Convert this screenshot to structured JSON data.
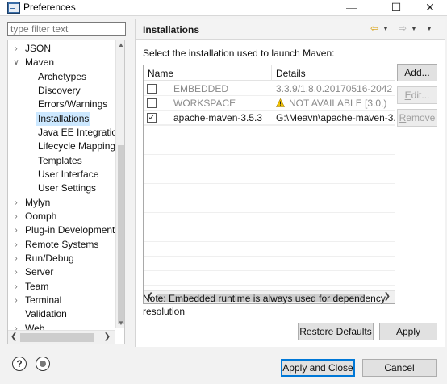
{
  "window": {
    "title": "Preferences",
    "minimize_glyph": "—",
    "maximize_glyph": "☐",
    "close_glyph": "✕"
  },
  "sidebar": {
    "filter_placeholder": "type filter text",
    "items": [
      {
        "label": "JSON",
        "twisty": ">"
      },
      {
        "label": "Maven",
        "twisty": "v"
      },
      {
        "label": "Archetypes",
        "twisty": ""
      },
      {
        "label": "Discovery",
        "twisty": ""
      },
      {
        "label": "Errors/Warnings",
        "twisty": ""
      },
      {
        "label": "Installations",
        "twisty": "",
        "selected": true
      },
      {
        "label": "Java EE Integratio",
        "twisty": ""
      },
      {
        "label": "Lifecycle Mapping",
        "twisty": ""
      },
      {
        "label": "Templates",
        "twisty": ""
      },
      {
        "label": "User Interface",
        "twisty": ""
      },
      {
        "label": "User Settings",
        "twisty": ""
      },
      {
        "label": "Mylyn",
        "twisty": ">"
      },
      {
        "label": "Oomph",
        "twisty": ">"
      },
      {
        "label": "Plug-in Development",
        "twisty": ">"
      },
      {
        "label": "Remote Systems",
        "twisty": ">"
      },
      {
        "label": "Run/Debug",
        "twisty": ">"
      },
      {
        "label": "Server",
        "twisty": ">"
      },
      {
        "label": "Team",
        "twisty": ">"
      },
      {
        "label": "Terminal",
        "twisty": ">"
      },
      {
        "label": "Validation",
        "twisty": ""
      },
      {
        "label": "Web",
        "twisty": ">"
      }
    ]
  },
  "page": {
    "title": "Installations",
    "intro": "Select the installation used to launch Maven:",
    "columns": {
      "name": "Name",
      "details": "Details"
    },
    "rows": [
      {
        "checked": false,
        "name": "EMBEDDED",
        "details": "3.3.9/1.8.0.20170516-2042",
        "dimmed": true,
        "warning": false
      },
      {
        "checked": false,
        "name": "WORKSPACE",
        "details": "NOT AVAILABLE [3.0,)",
        "dimmed": true,
        "warning": true
      },
      {
        "checked": true,
        "name": "apache-maven-3.5.3",
        "details": "G:\\Meavn\\apache-maven-3.5",
        "dimmed": false,
        "warning": false
      }
    ],
    "buttons": {
      "add": "Add...",
      "edit": "Edit...",
      "remove": "Remove",
      "restore_defaults": "Restore Defaults",
      "apply": "Apply"
    },
    "note": "Note: Embedded runtime is always used for dependency resolution"
  },
  "footer": {
    "apply_and_close": "Apply and Close",
    "cancel": "Cancel"
  },
  "colors": {
    "selection": "#cce8ff",
    "nav_arrow": "#d79b00",
    "default_button_border": "#0078d7"
  }
}
